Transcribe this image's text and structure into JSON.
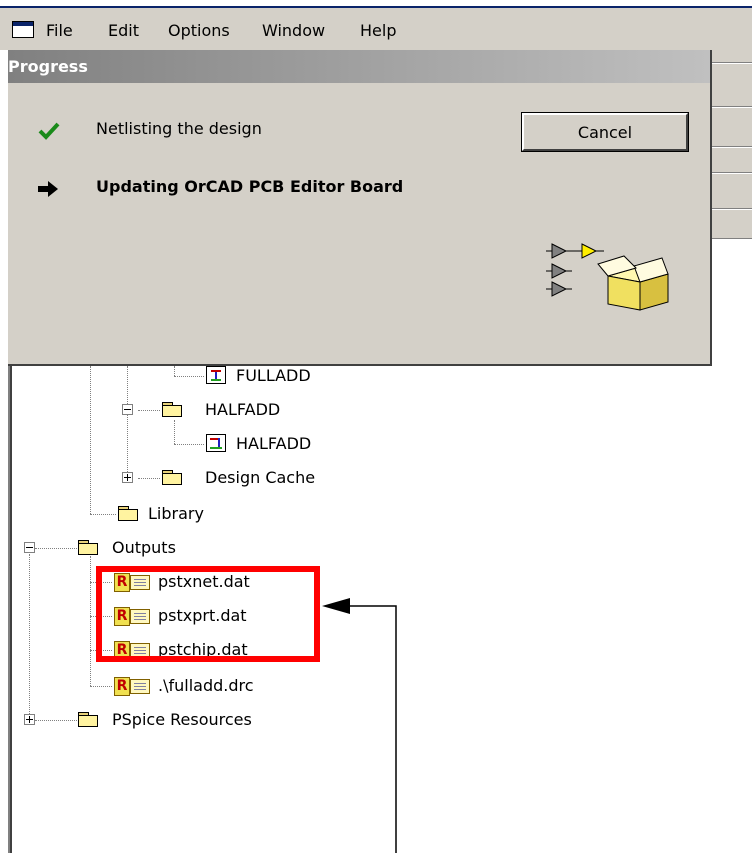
{
  "menubar": {
    "items": [
      "File",
      "Edit",
      "Options",
      "Window",
      "Help"
    ]
  },
  "progress": {
    "title": "Progress",
    "steps": [
      {
        "status": "done",
        "label": "Netlisting the design"
      },
      {
        "status": "current",
        "label": "Updating OrCAD PCB Editor Board"
      }
    ],
    "cancel_label": "Cancel"
  },
  "tree": {
    "fulladd_schematic": "FULLADD",
    "halfadd_folder": "HALFADD",
    "halfadd_schematic": "HALFADD",
    "design_cache": "Design Cache",
    "library": "Library",
    "outputs": "Outputs",
    "output_files": [
      "pstxnet.dat",
      "pstxprt.dat",
      "pstchip.dat",
      ".\\fulladd.drc"
    ],
    "pspice_resources": "PSpice Resources"
  },
  "colors": {
    "highlight": "#ff0000",
    "dialog_bg": "#d4d0c8",
    "check": "#1a8a1a"
  }
}
